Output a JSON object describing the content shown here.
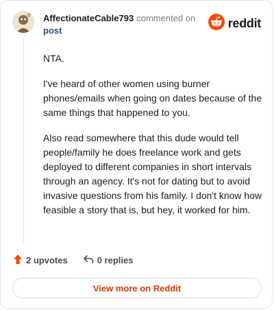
{
  "comment": {
    "author": "AffectionateCable793",
    "action_text": "commented on",
    "target": "post",
    "paragraphs": [
      "NTA.",
      "I've heard of other women using burner phones/emails when going on dates because of the same things that happened to you.",
      "Also read somewhere that this dude would tell people/family he does freelance work and gets deployed to different companies in short intervals through an agency. It's not for dating but to avoid invasive questions from his family. I don't know how feasible a story that is, but hey, it worked for him."
    ]
  },
  "brand": {
    "name": "reddit",
    "color": "#ff4500",
    "icon": "reddit-logo-icon"
  },
  "actions": {
    "upvotes": "2 upvotes",
    "replies": "0 replies",
    "upvote_icon": "upvote-arrow-icon",
    "reply_icon": "reply-arrow-icon"
  },
  "footer": {
    "view_more": "View more on Reddit",
    "accent": "#d93a00"
  }
}
